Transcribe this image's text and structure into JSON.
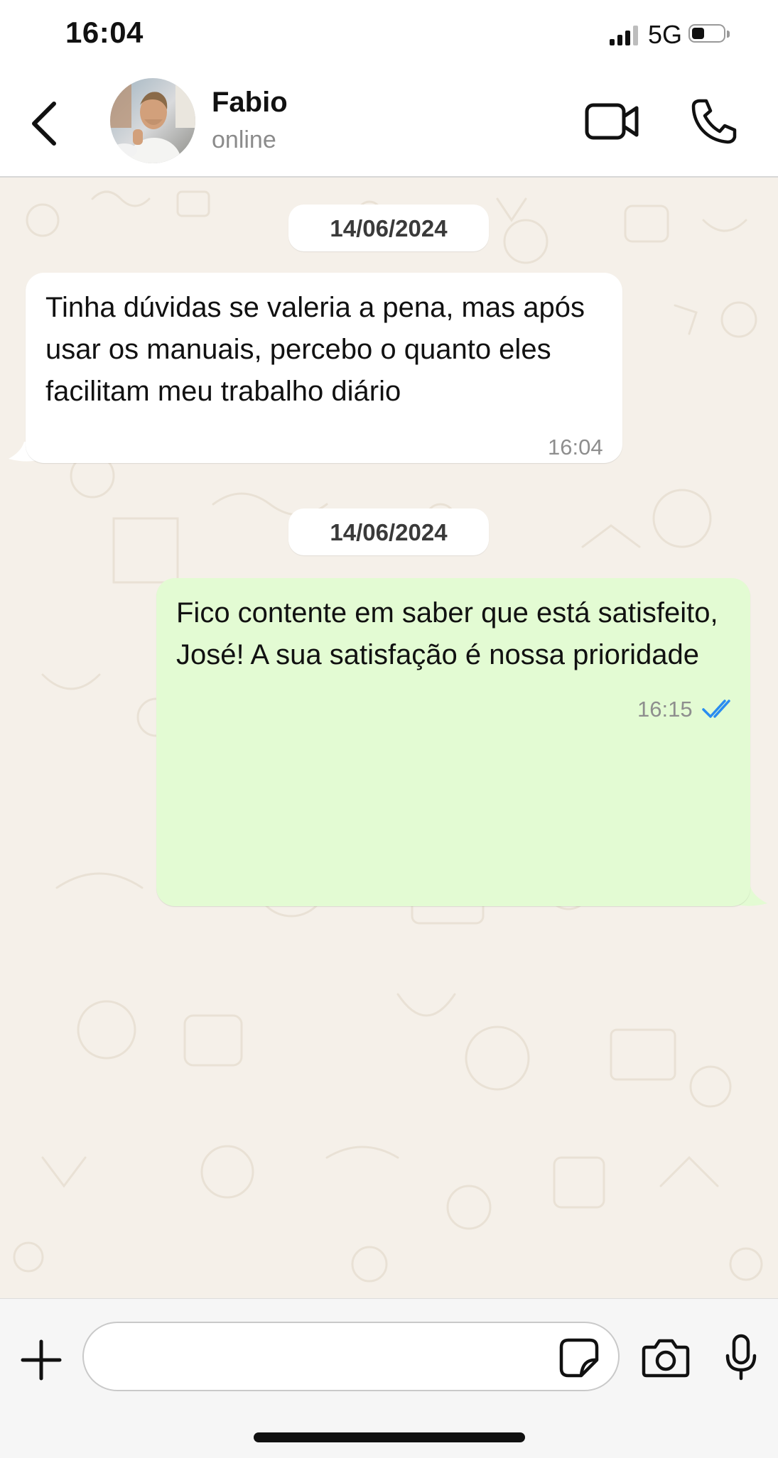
{
  "status_bar": {
    "time": "16:04",
    "network": "5G",
    "signal_bars": 4,
    "battery_level": 0.4
  },
  "header": {
    "contact_name": "Fabio",
    "contact_status": "online",
    "icons": [
      "chevron-left-icon",
      "avatar",
      "video-camera-icon",
      "phone-icon"
    ]
  },
  "chat": {
    "wallpaper_color": "#f5f0e9",
    "messages": [
      {
        "date": "14/06/2024",
        "direction": "incoming",
        "text": "Tinha dúvidas se valeria a pena, mas após usar os manuais, percebo o quanto eles facilitam meu trabalho diário",
        "time": "16:04"
      },
      {
        "date": "14/06/2024",
        "direction": "outgoing",
        "text": "Fico contente em saber que está satisfeito, José! A sua satisfação é nossa prioridade",
        "time": "16:15",
        "status": "read"
      }
    ]
  },
  "input_bar": {
    "placeholder": "",
    "value": "",
    "icons": [
      "plus-icon",
      "sticker-icon",
      "camera-icon",
      "microphone-icon"
    ]
  },
  "colors": {
    "incoming_bubble": "#ffffff",
    "outgoing_bubble": "#e3fbd3",
    "read_ticks": "#2a8cf0",
    "date_pill": "#ffffff"
  }
}
